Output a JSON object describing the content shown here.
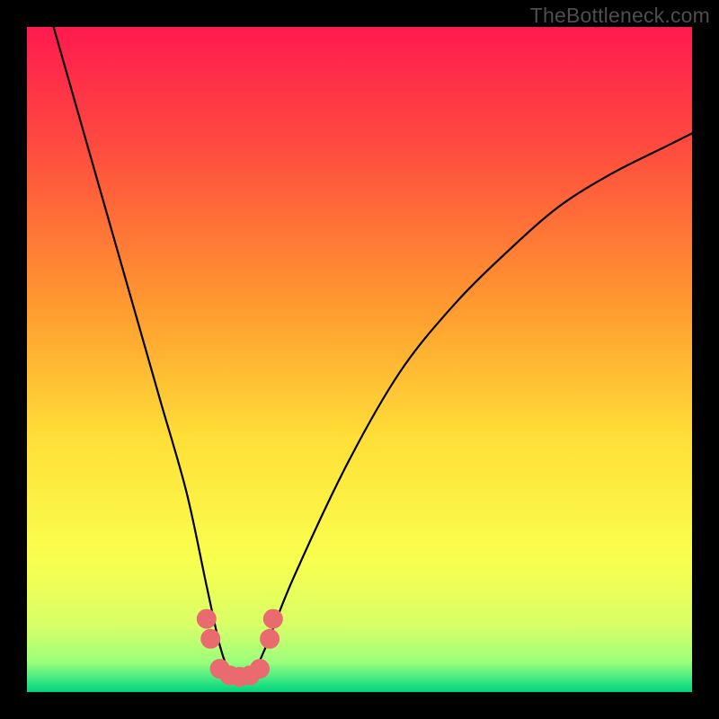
{
  "watermark": "TheBottleneck.com",
  "chart_data": {
    "type": "line",
    "title": "",
    "xlabel": "",
    "ylabel": "",
    "xlim": [
      0,
      100
    ],
    "ylim": [
      0,
      100
    ],
    "background_gradient_stops": [
      {
        "offset": 0,
        "color": "#ff1a4f"
      },
      {
        "offset": 0.18,
        "color": "#ff4b3f"
      },
      {
        "offset": 0.42,
        "color": "#ff9a2f"
      },
      {
        "offset": 0.62,
        "color": "#ffe038"
      },
      {
        "offset": 0.8,
        "color": "#f9ff4d"
      },
      {
        "offset": 0.9,
        "color": "#d8ff68"
      },
      {
        "offset": 0.955,
        "color": "#9cff7c"
      },
      {
        "offset": 0.985,
        "color": "#30e583"
      },
      {
        "offset": 1.0,
        "color": "#00d37a"
      }
    ],
    "series": [
      {
        "name": "bottleneck-curve",
        "x": [
          4,
          8,
          12,
          16,
          20,
          24,
          27,
          29,
          30.5,
          32,
          34,
          36,
          40,
          48,
          56,
          64,
          72,
          80,
          88,
          96,
          100
        ],
        "y": [
          100,
          86,
          72,
          58,
          44,
          30,
          16,
          7,
          3,
          2,
          3,
          7,
          17,
          34,
          48,
          58,
          66,
          73,
          78,
          82,
          84
        ]
      }
    ],
    "markers": {
      "name": "highlight-dots",
      "color": "#e96a6f",
      "points": [
        {
          "x": 27.0,
          "y": 11.0
        },
        {
          "x": 27.6,
          "y": 8.0
        },
        {
          "x": 29.0,
          "y": 3.5
        },
        {
          "x": 30.5,
          "y": 2.5
        },
        {
          "x": 32.0,
          "y": 2.3
        },
        {
          "x": 33.5,
          "y": 2.5
        },
        {
          "x": 35.0,
          "y": 3.5
        },
        {
          "x": 36.5,
          "y": 8.0
        },
        {
          "x": 37.0,
          "y": 11.0
        }
      ]
    }
  }
}
